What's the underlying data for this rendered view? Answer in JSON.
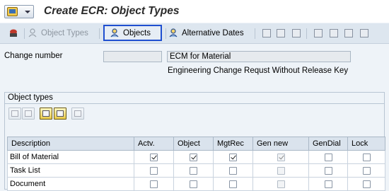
{
  "window": {
    "title": "Create ECR: Object Types"
  },
  "toolbar": {
    "object_types": "Object Types",
    "objects": "Objects",
    "alternative_dates": "Alternative Dates"
  },
  "header": {
    "change_number_label": "Change number",
    "change_number_value": "",
    "description_value": "ECM for Material",
    "change_type_text": "Engineering Change Requst Without Release Key"
  },
  "group": {
    "title": "Object types",
    "columns": [
      "Description",
      "Actv.",
      "Object",
      "MgtRec",
      "Gen new",
      "GenDial",
      "Lock"
    ],
    "rows": [
      {
        "description": "Bill of Material",
        "actv": true,
        "object": true,
        "mgtrec": true,
        "gen_new": true,
        "gendial": false,
        "lock": false
      },
      {
        "description": "Task List",
        "actv": false,
        "object": false,
        "mgtrec": false,
        "gen_new": false,
        "gendial": false,
        "lock": false
      },
      {
        "description": "Document",
        "actv": false,
        "object": false,
        "mgtrec": false,
        "gen_new": false,
        "gendial": false,
        "lock": false
      }
    ]
  },
  "colors": {
    "selection_border": "#1f4fd0",
    "toolbar_bg": "#dde6ef",
    "screen_bg": "#eef3f8"
  }
}
